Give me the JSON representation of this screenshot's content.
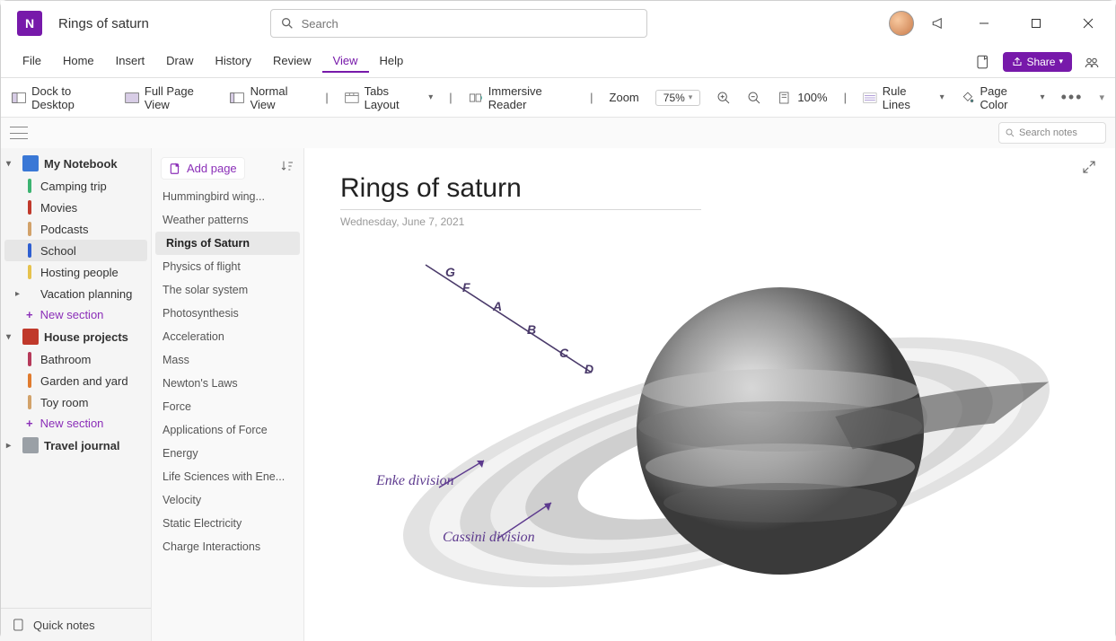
{
  "app": {
    "icon_letter": "N",
    "title": "Rings of saturn"
  },
  "search": {
    "placeholder": "Search"
  },
  "menus": [
    "File",
    "Home",
    "Insert",
    "Draw",
    "History",
    "Review",
    "View",
    "Help"
  ],
  "active_menu": "View",
  "share_label": "Share",
  "ribbon": {
    "dock": "Dock to Desktop",
    "fullpage": "Full Page View",
    "normal": "Normal View",
    "tabs": "Tabs Layout",
    "immersive": "Immersive Reader",
    "zoom_label": "Zoom",
    "zoom_pct": "75%",
    "zoom_100": "100%",
    "rule": "Rule Lines",
    "pagecolor": "Page Color"
  },
  "search_notes_placeholder": "Search notes",
  "notebooks": [
    {
      "name": "My Notebook",
      "color": "#3a78d6",
      "expanded": true,
      "sections": [
        {
          "name": "Camping trip",
          "color": "#3cb371"
        },
        {
          "name": "Movies",
          "color": "#c0392b"
        },
        {
          "name": "Podcasts",
          "color": "#d2a26a"
        },
        {
          "name": "School",
          "color": "#2e5fd1",
          "selected": true
        },
        {
          "name": "Hosting people",
          "color": "#e6c24d"
        },
        {
          "name": "Vacation planning",
          "color": "",
          "has_children": true
        }
      ]
    },
    {
      "name": "House projects",
      "color": "#c0392b",
      "expanded": true,
      "sections": [
        {
          "name": "Bathroom",
          "color": "#b63a5a"
        },
        {
          "name": "Garden and yard",
          "color": "#e07b2e"
        },
        {
          "name": "Toy room",
          "color": "#d2a26a"
        }
      ]
    },
    {
      "name": "Travel journal",
      "color": "#9aa0a6",
      "expanded": false,
      "sections": []
    }
  ],
  "new_section_label": "New section",
  "quick_notes_label": "Quick notes",
  "add_page_label": "Add page",
  "pages": [
    "Hummingbird wing...",
    "Weather patterns",
    "Rings of Saturn",
    "Physics of flight",
    "The solar system",
    "Photosynthesis",
    "Acceleration",
    "Mass",
    "Newton's Laws",
    "Force",
    "Applications of Force",
    "Energy",
    "Life Sciences with Ene...",
    "Velocity",
    "Static Electricity",
    "Charge Interactions"
  ],
  "selected_page": "Rings of Saturn",
  "canvas": {
    "title": "Rings of saturn",
    "date": "Wednesday, June 7, 2021",
    "ring_letters": [
      "G",
      "F",
      "A",
      "B",
      "C",
      "D"
    ],
    "ink_labels": {
      "enke": "Enke division",
      "cassini": "Cassini division"
    }
  }
}
